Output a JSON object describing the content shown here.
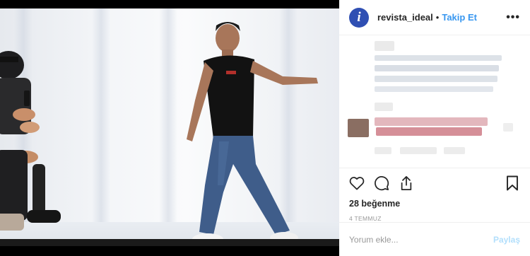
{
  "post": {
    "account": {
      "username": "revista_ideal",
      "avatar_letter": "i",
      "follow_label": "Takip Et",
      "separator": "•"
    },
    "more_icon": "ellipsis-icon",
    "likes_label": "28 beğenme",
    "date_label": "4 TEMMUZ",
    "comment_box": {
      "placeholder": "Yorum ekle...",
      "post_label": "Paylaş"
    },
    "action_icons": [
      "heart-icon",
      "comment-icon",
      "share-icon",
      "bookmark-icon"
    ]
  },
  "colors": {
    "accent": "#3897f0",
    "avatar": "#2f4fb3",
    "post_disabled": "#b2dffc",
    "text": "#262626",
    "muted": "#999999"
  }
}
